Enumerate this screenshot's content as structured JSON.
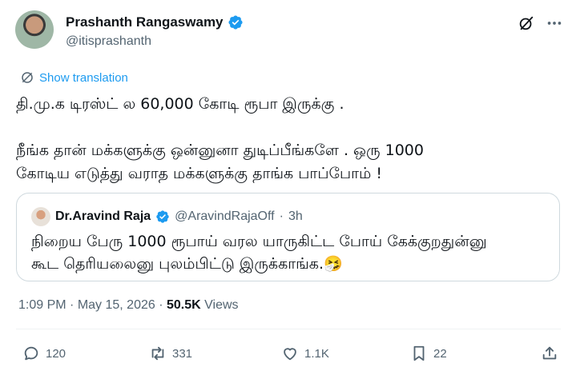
{
  "author": {
    "name": "Prashanth Rangaswamy",
    "handle": "@itisprashanth"
  },
  "translation_link": "Show translation",
  "tweet_text": "தி.மு.க டிரஸ்ட் ல 60,000 கோடி ரூபா இருக்கு .\n\nநீங்க தான் மக்களுக்கு ஒன்னுனா துடிப்பீங்களே . ஒரு 1000\nகோடிய எடுத்து வராத மக்களுக்கு தாங்க பாப்போம் !",
  "quoted_post": {
    "name": "Dr.Aravind Raja",
    "handle": "@AravindRajaOff",
    "separator": "·",
    "time": "3h",
    "text": "நிறைய பேரு 1000 ரூபாய் வரல யாருகிட்ட போய் கேக்குறதுன்னு\nகூட தெரியலைனு புலம்பிட்டு இருக்காங்க.🤧"
  },
  "meta": {
    "time": "1:09 PM",
    "dot": " · ",
    "date": "May 15, 2026",
    "views_count": "50.5K",
    "views_label": " Views"
  },
  "actions": {
    "replies": "120",
    "reposts": "331",
    "likes": "1.1K",
    "bookmarks": "22"
  },
  "colors": {
    "accent": "#1d9bf0",
    "secondary_text": "#536471"
  },
  "icons": [
    "verified-badge-icon",
    "grok-icon",
    "more-icon",
    "translate-icon",
    "reply-icon",
    "repost-icon",
    "like-icon",
    "bookmark-icon",
    "share-icon"
  ]
}
